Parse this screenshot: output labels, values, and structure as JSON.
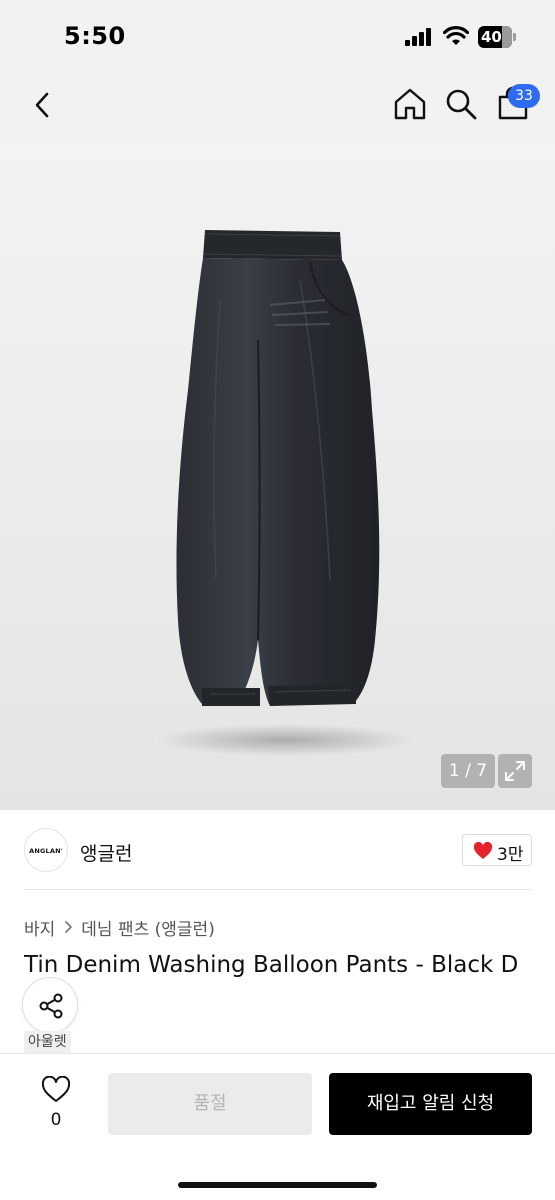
{
  "status_bar": {
    "time": "5:50",
    "battery": "40"
  },
  "nav": {
    "back_icon": "chevron-left-icon",
    "home_icon": "home-icon",
    "search_icon": "search-icon",
    "cart_icon": "shopping-bag-icon",
    "cart_count": "33"
  },
  "gallery": {
    "counter": "1 / 7",
    "expand_icon": "expand-icon"
  },
  "brand": {
    "logo_text": "ANGLAN'",
    "name": "앵글런",
    "likes": "3만",
    "like_icon": "heart-icon"
  },
  "breadcrumb": {
    "level1": "바지",
    "level2": "데님 팬츠 (앵글런)"
  },
  "product": {
    "title": "Tin Denim Washing Balloon Pants - Black D",
    "outlet_tag": "아울렛"
  },
  "bottom_bar": {
    "wish_count": "0",
    "soldout_label": "품절",
    "restock_label": "재입고 알림 신청"
  },
  "colors": {
    "accent": "#2f6bf0",
    "heart": "#e5212b",
    "primary_button": "#000000",
    "disabled_button": "#ebebeb"
  }
}
